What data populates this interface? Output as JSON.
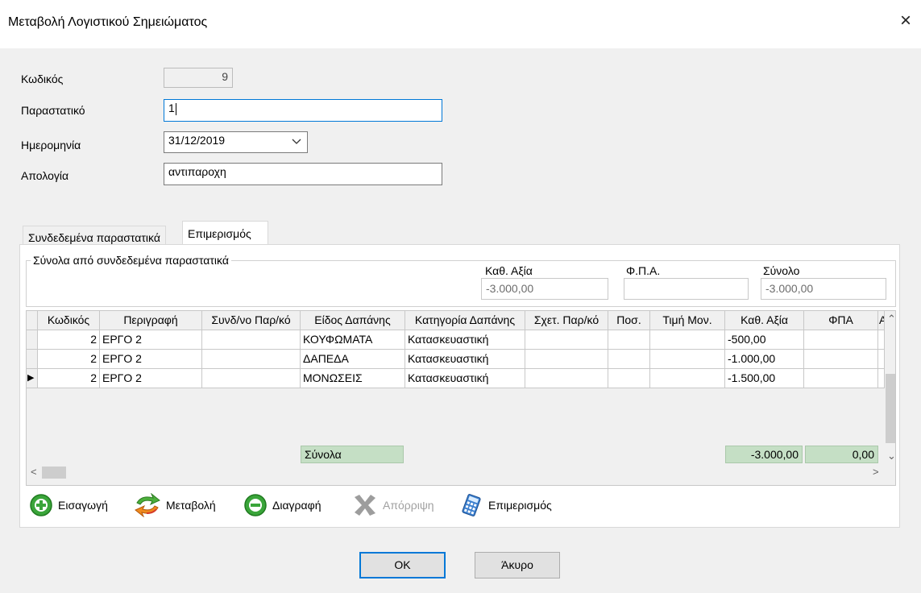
{
  "window": {
    "title": "Μεταβολή Λογιστικού Σημειώματος",
    "close_glyph": "×"
  },
  "form": {
    "code_label": "Κωδικός",
    "code_value": "9",
    "doc_label": "Παραστατικό",
    "doc_value": "1",
    "date_label": "Ημερομηνία",
    "date_value": "31/12/2019",
    "reason_label": "Απολογία",
    "reason_value": "αντιπαροχη"
  },
  "tabs": [
    {
      "label": "Συνδεδεμένα παραστατικά",
      "active": false
    },
    {
      "label": "Επιμερισμός",
      "active": true
    }
  ],
  "summary": {
    "group_label": "Σύνολα από συνδεδεμένα παραστατικά",
    "net_label": "Καθ. Αξία",
    "net_value": "-3.000,00",
    "vat_label": "Φ.Π.Α.",
    "vat_value": "",
    "total_label": "Σύνολο",
    "total_value": "-3.000,00"
  },
  "grid": {
    "columns": [
      "Κωδικός",
      "Περιγραφή",
      "Συνδ/νο Παρ/κό",
      "Είδος Δαπάνης",
      "Κατηγορία Δαπάνης",
      "Σχετ. Παρ/κό",
      "Ποσ.",
      "Τιμή Μον.",
      "Καθ. Αξία",
      "ΦΠΑ",
      "Α"
    ],
    "rows": [
      {
        "code": "2",
        "desc": "ΕΡΓΟ 2",
        "linked": "",
        "type": "ΚΟΥΦΩΜΑΤΑ",
        "category": "Κατασκευαστική",
        "rel": "",
        "qty": "",
        "price": "",
        "net": "-500,00",
        "vat": ""
      },
      {
        "code": "2",
        "desc": "ΕΡΓΟ 2",
        "linked": "",
        "type": "ΔΑΠΕΔΑ",
        "category": "Κατασκευαστική",
        "rel": "",
        "qty": "",
        "price": "",
        "net": "-1.000,00",
        "vat": ""
      },
      {
        "code": "2",
        "desc": "ΕΡΓΟ 2",
        "linked": "",
        "type": "ΜΟΝΩΣΕΙΣ",
        "category": "Κατασκευαστική",
        "rel": "",
        "qty": "",
        "price": "",
        "net": "-1.500,00",
        "vat": ""
      }
    ],
    "current_row_marker": "▶",
    "totals_label": "Σύνολα",
    "totals_net": "-3.000,00",
    "totals_vat": "0,00"
  },
  "toolbar": {
    "insert": "Εισαγωγή",
    "modify": "Μεταβολή",
    "delete": "Διαγραφή",
    "reject": "Απόρριψη",
    "allocate": "Επιμερισμός"
  },
  "buttons": {
    "ok": "OK",
    "cancel": "Άκυρο"
  },
  "colors": {
    "accent": "#0078d7",
    "totals_bg": "#c5dfc5",
    "insert_green": "#3aa53a"
  }
}
